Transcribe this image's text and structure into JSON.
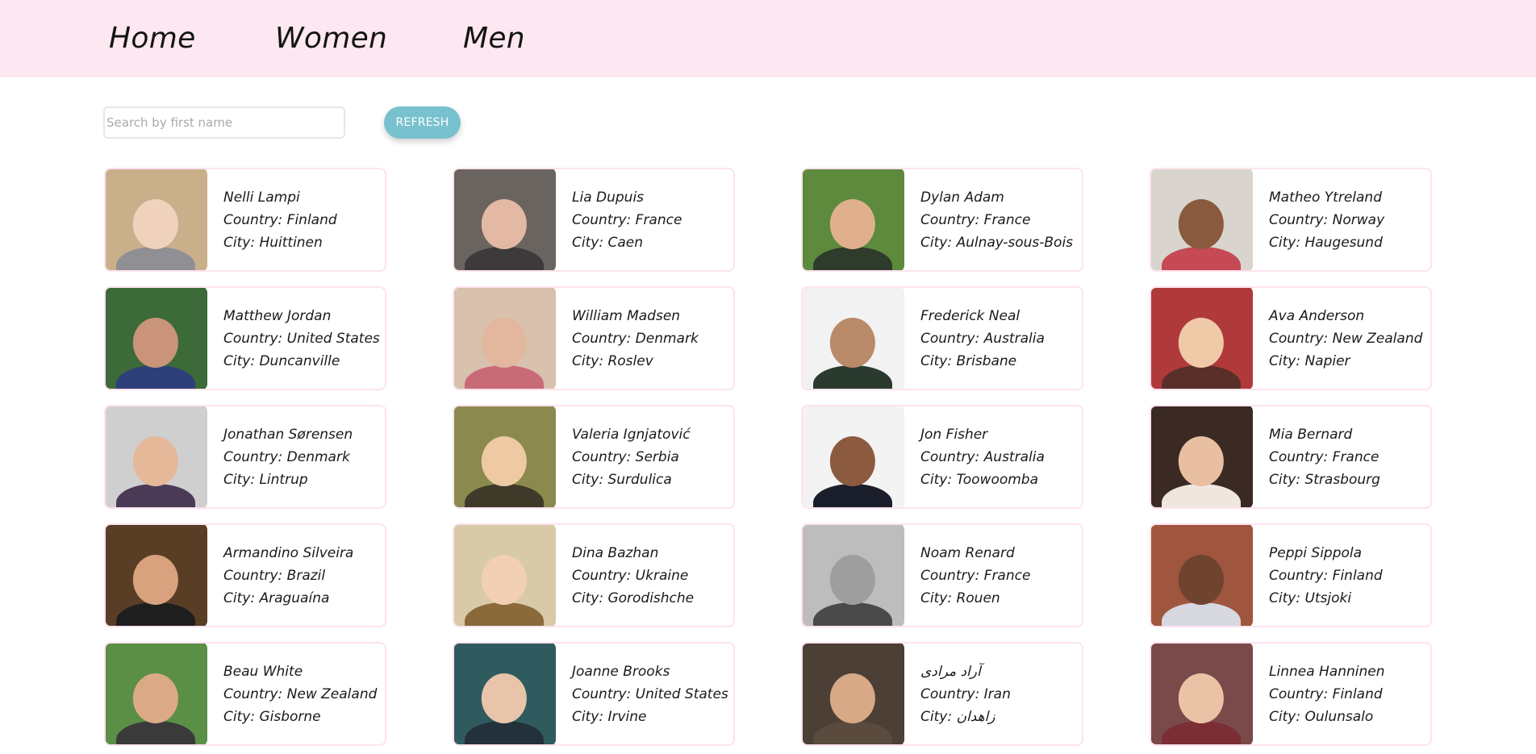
{
  "nav": {
    "home": "Home",
    "women": "Women",
    "men": "Men"
  },
  "search": {
    "placeholder": "Search by first name",
    "value": ""
  },
  "refresh_label": "REFRESH",
  "colors": {
    "nav_bg": "#fde7f1",
    "card_border": "#fde3ee",
    "refresh_bg": "#78c1ce"
  },
  "users": [
    {
      "name": "Nelli Lampi",
      "country": "Country: Finland",
      "city": "City: Huittinen",
      "photo": "avatar-photo",
      "bg": "#c9b08a",
      "skin": "#f0d2bd",
      "shirt": "#8f8f94"
    },
    {
      "name": "Lia Dupuis",
      "country": "Country: France",
      "city": "City: Caen",
      "photo": "avatar-photo",
      "bg": "#6a6460",
      "skin": "#e3b9a3",
      "shirt": "#3c3a3a"
    },
    {
      "name": "Dylan Adam",
      "country": "Country: France",
      "city": "City: Aulnay-sous-Bois",
      "photo": "avatar-photo",
      "bg": "#5d8a3c",
      "skin": "#e0b08e",
      "shirt": "#2f3b2b"
    },
    {
      "name": "Matheo Ytreland",
      "country": "Country: Norway",
      "city": "City: Haugesund",
      "photo": "avatar-photo",
      "bg": "#d9d4cd",
      "skin": "#8a5a3e",
      "shirt": "#c54a55"
    },
    {
      "name": "Matthew Jordan",
      "country": "Country: United States",
      "city": "City: Duncanville",
      "photo": "avatar-photo",
      "bg": "#3c6a38",
      "skin": "#c99479",
      "shirt": "#2e3f7a"
    },
    {
      "name": "William Madsen",
      "country": "Country: Denmark",
      "city": "City: Roslev",
      "photo": "avatar-photo",
      "bg": "#d8c1ad",
      "skin": "#e2b79d",
      "shirt": "#c96a78"
    },
    {
      "name": "Frederick Neal",
      "country": "Country: Australia",
      "city": "City: Brisbane",
      "photo": "avatar-photo",
      "bg": "#f2f2f2",
      "skin": "#b98a6a",
      "shirt": "#2b3a2f"
    },
    {
      "name": "Ava Anderson",
      "country": "Country: New Zealand",
      "city": "City: Napier",
      "photo": "avatar-photo",
      "bg": "#b03a3a",
      "skin": "#f0c9a9",
      "shirt": "#5a2f2a"
    },
    {
      "name": "Jonathan Sørensen",
      "country": "Country: Denmark",
      "city": "City: Lintrup",
      "photo": "avatar-photo",
      "bg": "#cfcfcf",
      "skin": "#e4b898",
      "shirt": "#4b3a56"
    },
    {
      "name": "Valeria Ignjatović",
      "country": "Country: Serbia",
      "city": "City: Surdulica",
      "photo": "avatar-photo",
      "bg": "#8b8a4e",
      "skin": "#efc9a2",
      "shirt": "#3e3a2a"
    },
    {
      "name": "Jon Fisher",
      "country": "Country: Australia",
      "city": "City: Toowoomba",
      "photo": "avatar-photo",
      "bg": "#f3f3f3",
      "skin": "#8c5a3f",
      "shirt": "#1b1e2b"
    },
    {
      "name": "Mia Bernard",
      "country": "Country: France",
      "city": "City: Strasbourg",
      "photo": "avatar-photo",
      "bg": "#3b2a24",
      "skin": "#e8c0a1",
      "shirt": "#efe6e0"
    },
    {
      "name": "Armandino Silveira",
      "country": "Country: Brazil",
      "city": "City: Araguaína",
      "photo": "avatar-photo",
      "bg": "#5a3d25",
      "skin": "#d7a27d",
      "shirt": "#1e1e1e"
    },
    {
      "name": "Dina Bazhan",
      "country": "Country: Ukraine",
      "city": "City: Gorodishche",
      "photo": "avatar-photo",
      "bg": "#d8c9a8",
      "skin": "#f1cfb4",
      "shirt": "#8a6a3a"
    },
    {
      "name": "Noam Renard",
      "country": "Country: France",
      "city": "City: Rouen",
      "photo": "avatar-photo",
      "bg": "#bdbdbd",
      "skin": "#9e9e9e",
      "shirt": "#4a4a4a"
    },
    {
      "name": "Peppi Sippola",
      "country": "Country: Finland",
      "city": "City: Utsjoki",
      "photo": "avatar-photo",
      "bg": "#a0553e",
      "skin": "#6e4330",
      "shirt": "#d8d8e0"
    },
    {
      "name": "Beau White",
      "country": "Country: New Zealand",
      "city": "City: Gisborne",
      "photo": "avatar-photo",
      "bg": "#5b8f46",
      "skin": "#dca987",
      "shirt": "#3a3a3a"
    },
    {
      "name": "Joanne Brooks",
      "country": "Country: United States",
      "city": "City: Irvine",
      "photo": "avatar-photo",
      "bg": "#2f5a5e",
      "skin": "#e8c4aa",
      "shirt": "#23323a"
    },
    {
      "name": "آراد مرادی",
      "country": "Country: Iran",
      "city": "City: زاهدان",
      "photo": "avatar-photo",
      "bg": "#4b3f36",
      "skin": "#d7a987",
      "shirt": "#5a4b3e"
    },
    {
      "name": "Linnea Hanninen",
      "country": "Country: Finland",
      "city": "City: Oulunsalo",
      "photo": "avatar-photo",
      "bg": "#7a4a4a",
      "skin": "#eac3a6",
      "shirt": "#7b2e34"
    }
  ]
}
